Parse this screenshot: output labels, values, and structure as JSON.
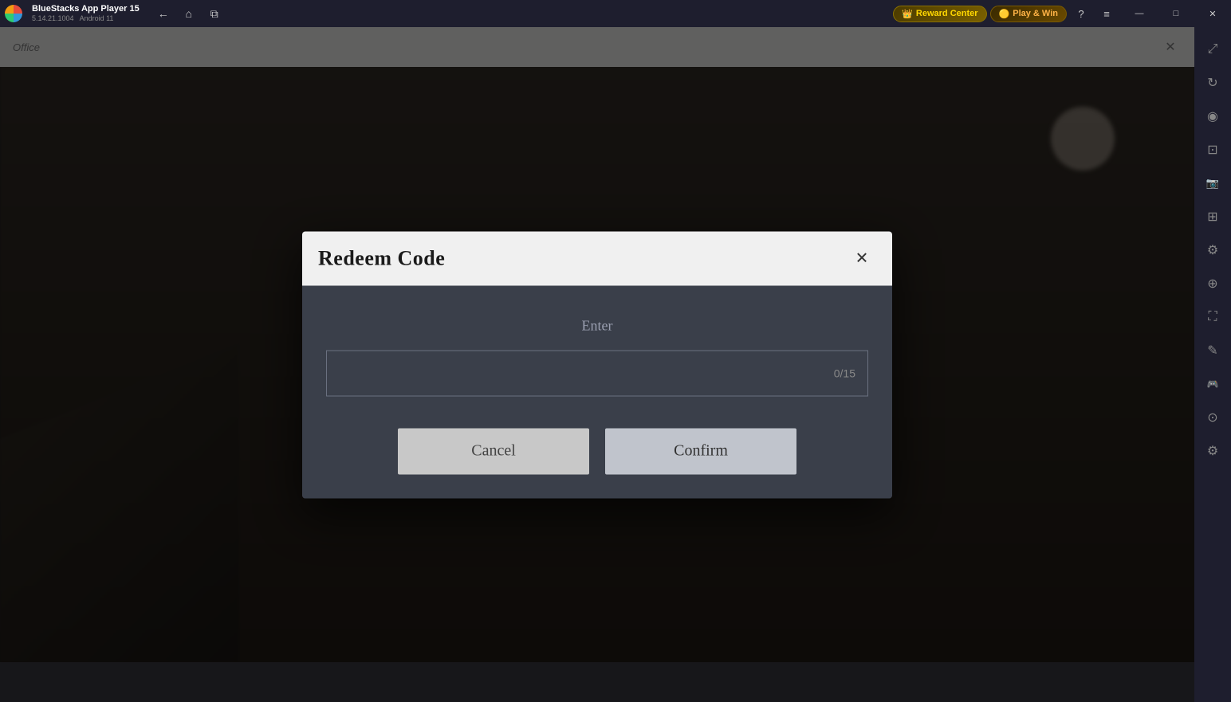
{
  "app": {
    "name": "BlueStacks App Player 15",
    "version": "5.14.21.1004",
    "platform": "Android 11"
  },
  "titlebar": {
    "nav": {
      "back_label": "←",
      "home_label": "⌂",
      "copy_label": "⧉"
    },
    "reward_center_label": "Reward Center",
    "play_win_label": "Play & Win",
    "help_label": "?",
    "menu_label": "≡",
    "minimize_label": "—",
    "maximize_label": "□",
    "close_label": "✕",
    "restore_label": "❐"
  },
  "sidebar": {
    "icons": [
      {
        "name": "expand-icon",
        "symbol": "⤢"
      },
      {
        "name": "rotate-icon",
        "symbol": "↻"
      },
      {
        "name": "volume-icon",
        "symbol": "◉"
      },
      {
        "name": "screenshot-icon",
        "symbol": "⊡"
      },
      {
        "name": "camera-icon",
        "symbol": "📷"
      },
      {
        "name": "apk-icon",
        "symbol": "⊞"
      },
      {
        "name": "settings-icon",
        "symbol": "⚙"
      },
      {
        "name": "zoom-icon",
        "symbol": "⊕"
      },
      {
        "name": "fullscreen-icon",
        "symbol": "⛶"
      },
      {
        "name": "edit-icon",
        "symbol": "✎"
      },
      {
        "name": "gamepad-icon",
        "symbol": "🎮"
      },
      {
        "name": "macro-icon",
        "symbol": "⊙"
      },
      {
        "name": "settings2-icon",
        "symbol": "⚙"
      }
    ]
  },
  "modal": {
    "title": "Redeem Code",
    "close_label": "✕",
    "enter_label": "Enter",
    "input_placeholder": "",
    "input_counter": "0/15",
    "cancel_label": "Cancel",
    "confirm_label": "Confirm"
  }
}
